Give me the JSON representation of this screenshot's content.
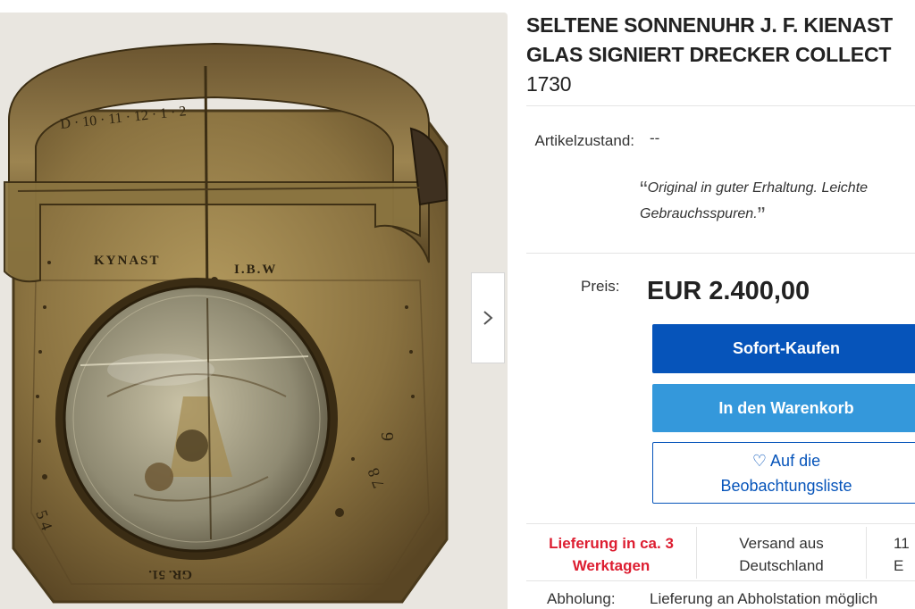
{
  "listing": {
    "title_line1": "SELTENE SONNENUHR J. F. KIENAST",
    "title_line2": "GLAS SIGNIERT DRECKER COLLECT",
    "title_line3": "1730",
    "condition_label": "Artikelzustand:",
    "condition_value": "--",
    "condition_desc": "Original in guter Erhaltung. Leichte Gebrauchsspuren.",
    "condition_desc_line1": "Original in guter Erhaltung. Leichte",
    "condition_desc_line2": "Gebrauchsspuren.",
    "price_label": "Preis:",
    "price_value": "EUR 2.400,00"
  },
  "actions": {
    "buy_now": "Sofort-Kaufen",
    "add_to_cart": "In den Warenkorb",
    "watchlist_line1": "Auf die",
    "watchlist_line2": "Beobachtungsliste"
  },
  "shipping": {
    "delivery": "Lieferung in ca. 3 Werktagen",
    "delivery_line1": "Lieferung in ca. 3",
    "delivery_line2": "Werktagen",
    "ships_from_line1": "Versand aus",
    "ships_from_line2": "Deutschland",
    "third_col_partial": "11 E",
    "pickup_label": "Abholung:",
    "pickup_value": "Lieferung an Abholstation möglich"
  },
  "photo": {
    "engraving_maker": "KYNAST",
    "engraving_initials": "I.B.W",
    "engraving_bottom": "GR. 51.",
    "engraving_top": "D · 10 · 11 · 12 · 1 · 2"
  },
  "icons": {
    "next": "chevron-right-icon",
    "heart": "heart-outline-icon"
  },
  "colors": {
    "primary_blue": "#0654ba",
    "secondary_blue": "#3498db",
    "delivery_red": "#dd1e31"
  }
}
